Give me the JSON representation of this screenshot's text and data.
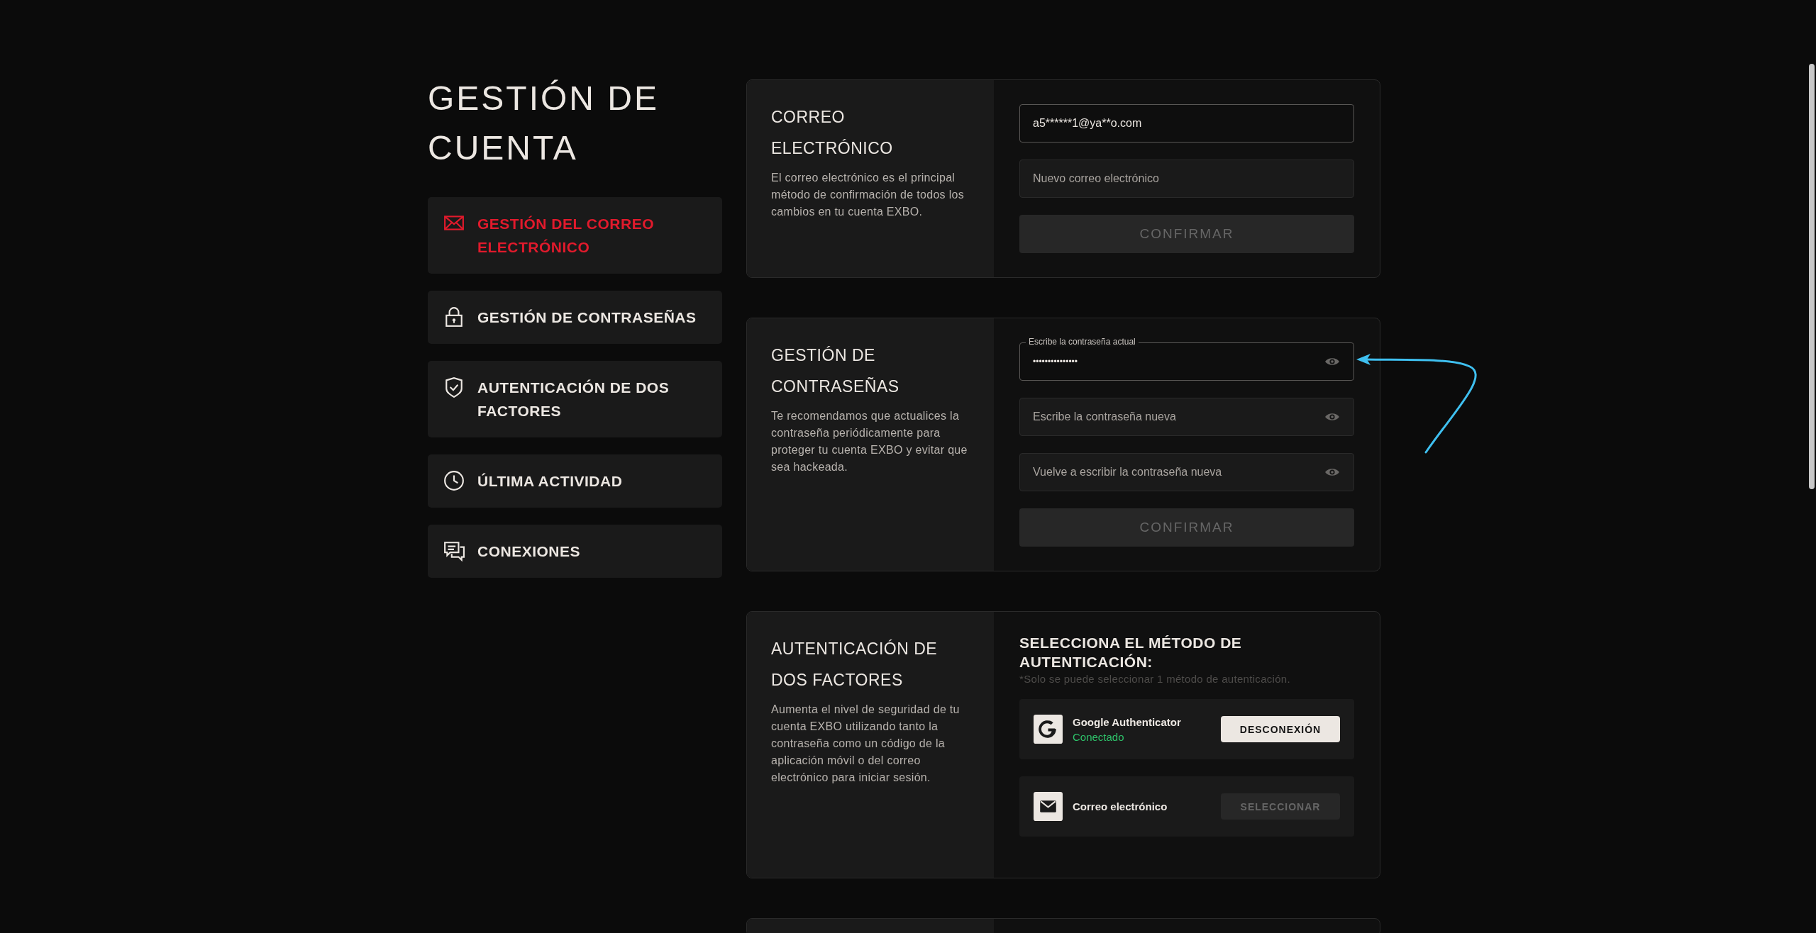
{
  "sidebar": {
    "title": "GESTIÓN DE CUENTA",
    "items": [
      {
        "label": "GESTIÓN DEL CORREO ELECTRÓNICO",
        "selected": true
      },
      {
        "label": "GESTIÓN DE CONTRASEÑAS",
        "selected": false
      },
      {
        "label": "AUTENTICACIÓN DE DOS FACTORES",
        "selected": false
      },
      {
        "label": "ÚLTIMA ACTIVIDAD",
        "selected": false
      },
      {
        "label": "CONEXIONES",
        "selected": false
      }
    ]
  },
  "sections": [
    {
      "kind": "email",
      "title": "CORREO ELECTRÓNICO",
      "description": "El correo electrónico es el principal método de confirmación de todos los cambios en tu cuenta EXBO.",
      "fields": [
        {
          "value": "a5******1@ya**o.com"
        },
        {
          "placeholder": "Nuevo correo electrónico"
        }
      ],
      "button": {
        "label": "CONFIRMAR",
        "disabled": true
      }
    },
    {
      "kind": "password",
      "title": "GESTIÓN DE CONTRASEÑAS",
      "description": "Te recomendamos que actualices la contraseña periódicamente para proteger tu cuenta EXBO y evitar que sea hackeada.",
      "fields": [
        {
          "label": "Escribe la contraseña actual",
          "value": "•••••••••••••••"
        },
        {
          "placeholder": "Escribe la contraseña nueva"
        },
        {
          "placeholder": "Vuelve a escribir la contraseña nueva"
        }
      ],
      "button": {
        "label": "CONFIRMAR",
        "disabled": true
      }
    },
    {
      "kind": "methods",
      "title": "AUTENTICACIÓN DE DOS FACTORES",
      "description": "Aumenta el nivel de seguridad de tu cuenta EXBO utilizando tanto la contraseña como un código de la aplicación móvil o del correo electrónico para iniciar sesión.",
      "heading": "SELECCIONA EL MÉTODO DE AUTENTICACIÓN:",
      "note": "*Solo se puede seleccionar 1 método de autenticación.",
      "methods": [
        {
          "name": "Google Authenticator",
          "status": "Conectado",
          "connected": true,
          "button": "DESCONEXIÓN"
        },
        {
          "name": "Correo electrónico",
          "connected": false,
          "button": "SELECCIONAR"
        }
      ]
    }
  ]
}
